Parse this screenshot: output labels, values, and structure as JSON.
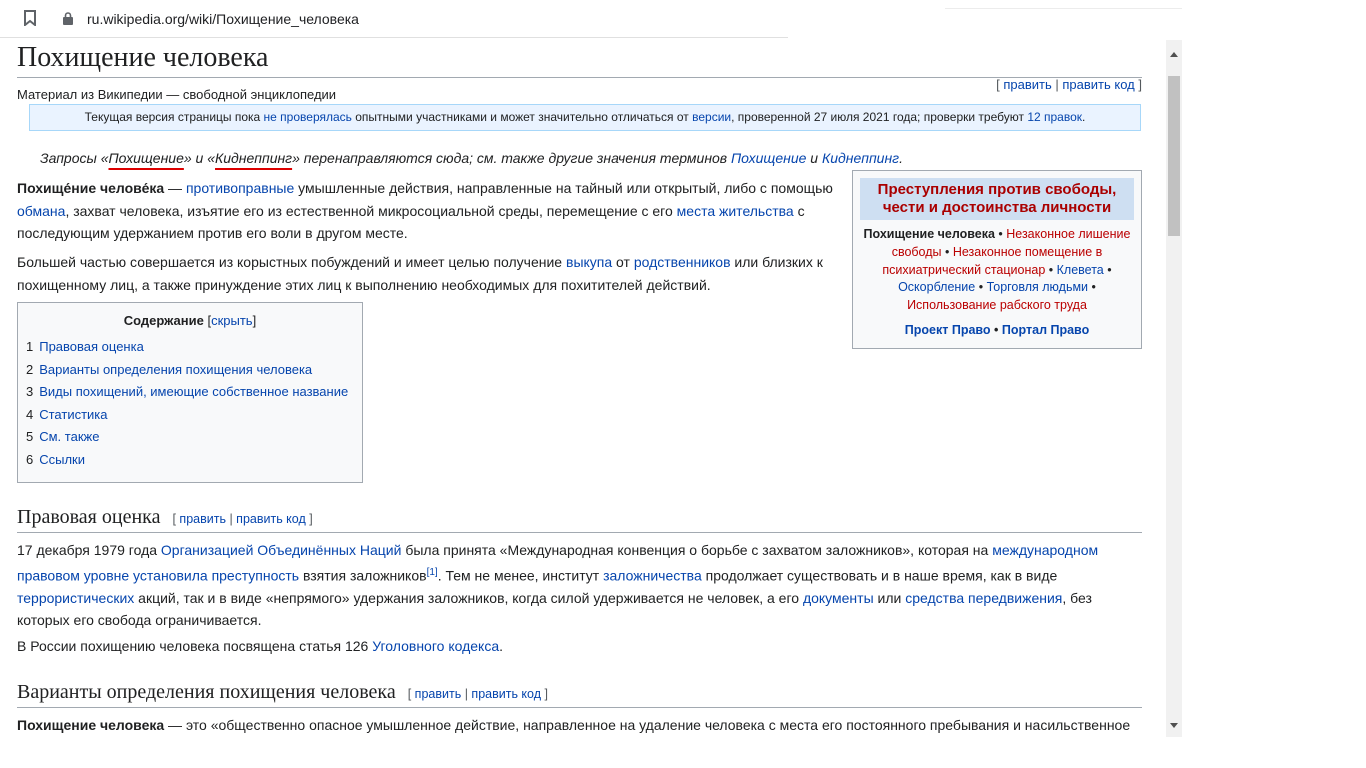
{
  "browser": {
    "url": "ru.wikipedia.org/wiki/Похищение_человека",
    "bookmark_icon": "bookmark-icon",
    "lock_icon": "lock-icon"
  },
  "article": {
    "title": "Похищение человека",
    "edit": "править",
    "edit_code": "править код",
    "tagline": "Материал из Википедии — свободной энциклопедии",
    "flagged": {
      "t1": "Текущая версия страницы пока ",
      "l1": "не проверялась",
      "t2": " опытными участниками и может значительно отличаться от ",
      "l2": "версии",
      "t3": ", проверенной 27 июля 2021 года; проверки требуют ",
      "l3": "12 правок",
      "t4": "."
    },
    "hatnote": {
      "t1": "Запросы «",
      "q1": "Похищение",
      "t2": "» и «",
      "q2": "Киднеппинг",
      "t3": "» перенаправляются сюда; см. также другие значения терминов ",
      "l1": "Похищение",
      "t4": " и ",
      "l2": "Киднеппинг",
      "t5": "."
    },
    "p1": {
      "b1": "Похище́ние челове́ка",
      "t1": " — ",
      "l1": "противоправные",
      "t2": " умышленные действия, направленные на тайный или открытый, либо с помощью ",
      "l2": "обмана",
      "t3": ", захват человека, изъятие его из естественной микросоциальной среды, перемещение с его ",
      "l3": "места жительства",
      "t4": " с последующим удержанием против его воли в другом месте."
    },
    "p2": {
      "t1": "Большей частью совершается из корыстных побуждений и имеет целью получение ",
      "l1": "выкупа",
      "t2": " от ",
      "l2": "родственников",
      "t3": " или близких к похищенному лиц, а также принуждение этих лиц к выполнению необходимых для похитителей действий."
    },
    "toc": {
      "title": "Содержание",
      "hide": "скрыть",
      "items": [
        {
          "num": "1",
          "label": "Правовая оценка"
        },
        {
          "num": "2",
          "label": "Варианты определения похищения человека"
        },
        {
          "num": "3",
          "label": "Виды похищений, имеющие собственное название"
        },
        {
          "num": "4",
          "label": "Статистика"
        },
        {
          "num": "5",
          "label": "См. также"
        },
        {
          "num": "6",
          "label": "Ссылки"
        }
      ]
    },
    "infobox": {
      "title": "Преступления против свободы, чести и достоинства личности",
      "current": "Похищение человека",
      "links": [
        "Незаконное лишение свободы",
        "Незаконное помещение в психиатрический стационар",
        "Клевета",
        "Оскорбление",
        "Торговля людьми",
        "Использование рабского труда"
      ],
      "project": "Проект Право",
      "portal": "Портал Право",
      "sep": " • "
    },
    "s1": {
      "title": "Правовая оценка",
      "p1": {
        "t1": "17 декабря 1979 года ",
        "l1": "Организацией Объединённых Наций",
        "t2": " была принята «Международная конвенция о борьбе с захватом заложников», которая на ",
        "l2": "международном правовом уровне установила преступность",
        "t3": " взятия заложников",
        "ref": "[1]",
        "t4": ". Тем не менее, институт ",
        "l3": "заложничества",
        "t5": " продолжает существовать и в наше время, как в виде ",
        "l4": "террористических",
        "t6": " акций, так и в виде «непрямого» удержания заложников, когда силой удерживается не человек, а его ",
        "l5": "документы",
        "t7": " или ",
        "l6": "средства передвижения",
        "t8": ", без которых его свобода ограничивается."
      },
      "p2": {
        "t1": "В России похищению человека посвящена статья 126 ",
        "l1": "Уголовного кодекса",
        "t2": "."
      }
    },
    "s2": {
      "title": "Варианты определения похищения человека",
      "p1": {
        "b1": "Похищение человека",
        "t1": " — это «общественно опасное умышленное действие, направленное на удаление человека с места его постоянного пребывания и насильственное"
      }
    }
  }
}
